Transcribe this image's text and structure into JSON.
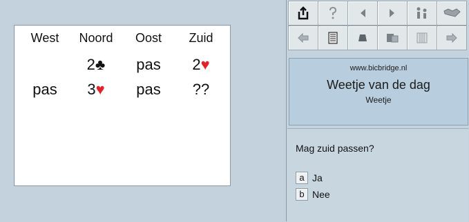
{
  "bidding": {
    "headers": [
      "West",
      "Noord",
      "Oost",
      "Zuid"
    ],
    "row1": [
      {
        "text": "",
        "suit": ""
      },
      {
        "text": "2",
        "suit": "♣",
        "suit_color": "black"
      },
      {
        "text": "pas",
        "suit": ""
      },
      {
        "text": "2",
        "suit": "♥",
        "suit_color": "red"
      }
    ],
    "row2": [
      {
        "text": "pas",
        "suit": ""
      },
      {
        "text": "3",
        "suit": "♥",
        "suit_color": "red"
      },
      {
        "text": "pas",
        "suit": ""
      },
      {
        "text": "??",
        "suit": ""
      }
    ]
  },
  "toolbar": {
    "row1": [
      "share-icon",
      "help-icon",
      "previous-icon",
      "next-icon",
      "players-icon",
      "handshake-icon"
    ],
    "row2": [
      "back-icon",
      "scorecard-icon",
      "cards-icon",
      "stack-icon",
      "grid-icon",
      "forward-icon"
    ]
  },
  "banner": {
    "url": "www.bicbridge.nl",
    "title": "Weetje van de dag",
    "subtitle": "Weetje"
  },
  "question": {
    "text": "Mag zuid passen?",
    "answers": [
      {
        "key": "a",
        "label": "Ja"
      },
      {
        "key": "b",
        "label": "Nee"
      }
    ]
  },
  "colors": {
    "background": "#c3d2dd",
    "heart": "#e0232a",
    "banner": "#b8cddd"
  }
}
